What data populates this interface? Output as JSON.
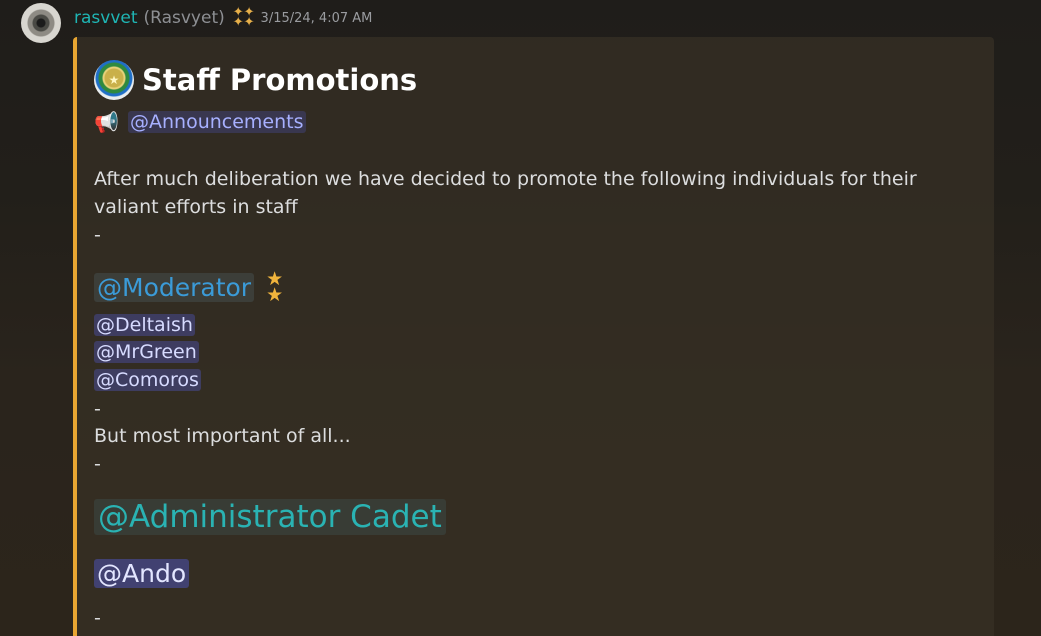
{
  "message": {
    "username": "rasvvet",
    "nickname": "(Rasvyet)",
    "timestamp": "3/15/24, 4:07 AM",
    "badge_icon": "stars-icon",
    "avatar_icon": "eye-avatar"
  },
  "embed": {
    "accent_color": "#e8a632",
    "title": "Staff Promotions",
    "title_icon": "medal-icon",
    "announce_icon": "megaphone-icon",
    "announce_mention": "@Announcements",
    "intro": "After much deliberation we have decided to promote the following individuals for their valiant efforts in staff",
    "dash": "-",
    "moderator_role": "@Moderator",
    "moderator_stars_icon": "stars-icon",
    "moderators": [
      "@Deltaish",
      "@MrGreen",
      "@Comoros"
    ],
    "important_text": "But most important of all...",
    "admin_role": "@Administrator Cadet",
    "admin_user": "@Ando"
  }
}
